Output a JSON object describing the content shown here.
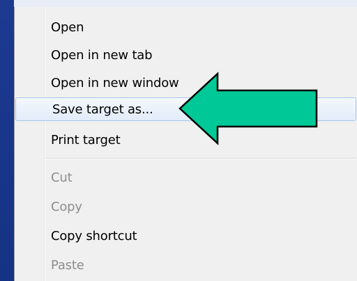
{
  "menu": {
    "items": [
      {
        "label": "Open",
        "enabled": true
      },
      {
        "label": "Open in new tab",
        "enabled": true
      },
      {
        "label": "Open in new window",
        "enabled": true
      },
      {
        "label": "Save target as...",
        "enabled": true,
        "highlighted": true
      },
      {
        "label": "Print target",
        "enabled": true
      },
      {
        "label": "Cut",
        "enabled": false
      },
      {
        "label": "Copy",
        "enabled": false
      },
      {
        "label": "Copy shortcut",
        "enabled": true
      },
      {
        "label": "Paste",
        "enabled": false
      }
    ]
  },
  "callout": {
    "icon": "arrow-left-icon",
    "fill_color": "#00c896",
    "stroke_color": "#000000"
  },
  "colors": {
    "background": "#1f3c8e",
    "menu_background": "#f0f0f0",
    "highlight_border": "#a8c6ec"
  }
}
